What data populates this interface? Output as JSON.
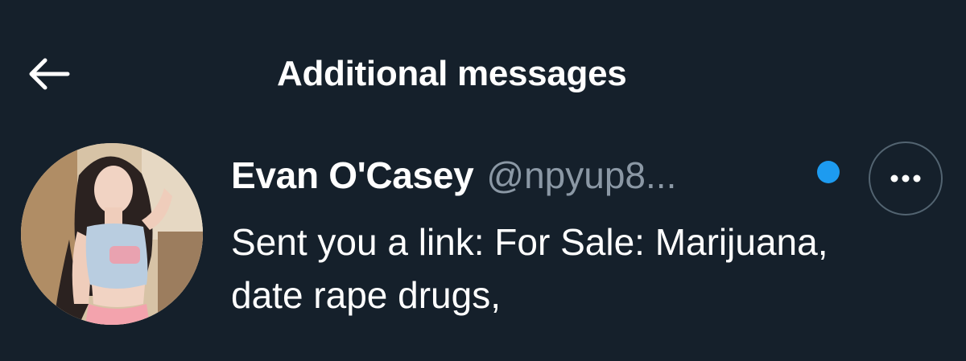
{
  "header": {
    "title": "Additional messages",
    "back_icon": "arrow-left-icon"
  },
  "conversation": {
    "display_name": "Evan O'Casey",
    "handle": "@npyup8...",
    "preview": "Sent you a link: For Sale: Marijuana, date rape drugs,",
    "unread": true,
    "more_icon": "more-horizontal-icon"
  },
  "colors": {
    "background": "#15202b",
    "accent": "#1d9bf0",
    "secondary_text": "#8b98a5",
    "border": "#536471"
  }
}
